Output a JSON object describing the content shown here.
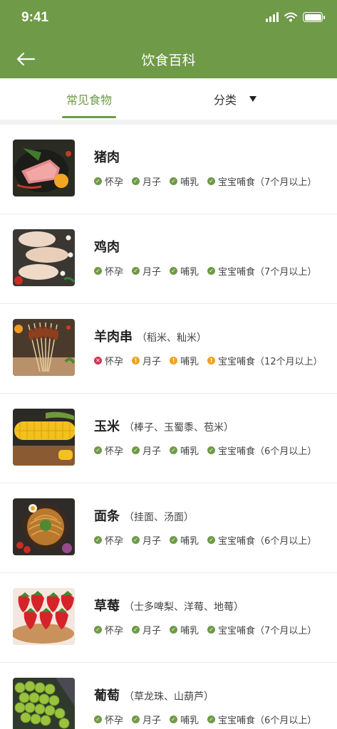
{
  "status_bar": {
    "time": "9:41"
  },
  "header": {
    "title": "饮食百科"
  },
  "tabs": {
    "common": "常见食物",
    "category": "分类"
  },
  "colors": {
    "brand_green": "#6f9a47",
    "caution_orange": "#f0a21c",
    "forbidden_red": "#d2334b"
  },
  "foods": [
    {
      "name": "猪肉",
      "alias": "",
      "image_icon": "pork-icon",
      "tags": [
        {
          "label": "怀孕",
          "status": "ok"
        },
        {
          "label": "月子",
          "status": "ok"
        },
        {
          "label": "哺乳",
          "status": "ok"
        },
        {
          "label": "宝宝哺食（7个月以上）",
          "status": "ok"
        }
      ]
    },
    {
      "name": "鸡肉",
      "alias": "",
      "image_icon": "chicken-icon",
      "tags": [
        {
          "label": "怀孕",
          "status": "ok"
        },
        {
          "label": "月子",
          "status": "ok"
        },
        {
          "label": "哺乳",
          "status": "ok"
        },
        {
          "label": "宝宝哺食（7个月以上）",
          "status": "ok"
        }
      ]
    },
    {
      "name": "羊肉串",
      "alias": "（稻米、籼米）",
      "image_icon": "lamb-skewer-icon",
      "tags": [
        {
          "label": "怀孕",
          "status": "no"
        },
        {
          "label": "月子",
          "status": "caution"
        },
        {
          "label": "哺乳",
          "status": "caution"
        },
        {
          "label": "宝宝哺食（12个月以上）",
          "status": "caution"
        }
      ]
    },
    {
      "name": "玉米",
      "alias": "（棒子、玉蜀黍、苞米）",
      "image_icon": "corn-icon",
      "tags": [
        {
          "label": "怀孕",
          "status": "ok"
        },
        {
          "label": "月子",
          "status": "ok"
        },
        {
          "label": "哺乳",
          "status": "ok"
        },
        {
          "label": "宝宝哺食（6个月以上）",
          "status": "ok"
        }
      ]
    },
    {
      "name": "面条",
      "alias": "（挂面、汤面）",
      "image_icon": "noodles-icon",
      "tags": [
        {
          "label": "怀孕",
          "status": "ok"
        },
        {
          "label": "月子",
          "status": "ok"
        },
        {
          "label": "哺乳",
          "status": "ok"
        },
        {
          "label": "宝宝哺食（6个月以上）",
          "status": "ok"
        }
      ]
    },
    {
      "name": "草莓",
      "alias": "（士多啤梨、洋莓、地莓）",
      "image_icon": "strawberry-icon",
      "tags": [
        {
          "label": "怀孕",
          "status": "ok"
        },
        {
          "label": "月子",
          "status": "ok"
        },
        {
          "label": "哺乳",
          "status": "ok"
        },
        {
          "label": "宝宝哺食（7个月以上）",
          "status": "ok"
        }
      ]
    },
    {
      "name": "葡萄",
      "alias": "（草龙珠、山葫芦）",
      "image_icon": "grape-icon",
      "tags": [
        {
          "label": "怀孕",
          "status": "ok"
        },
        {
          "label": "月子",
          "status": "ok"
        },
        {
          "label": "哺乳",
          "status": "ok"
        },
        {
          "label": "宝宝哺食（6个月以上）",
          "status": "ok"
        }
      ]
    }
  ]
}
